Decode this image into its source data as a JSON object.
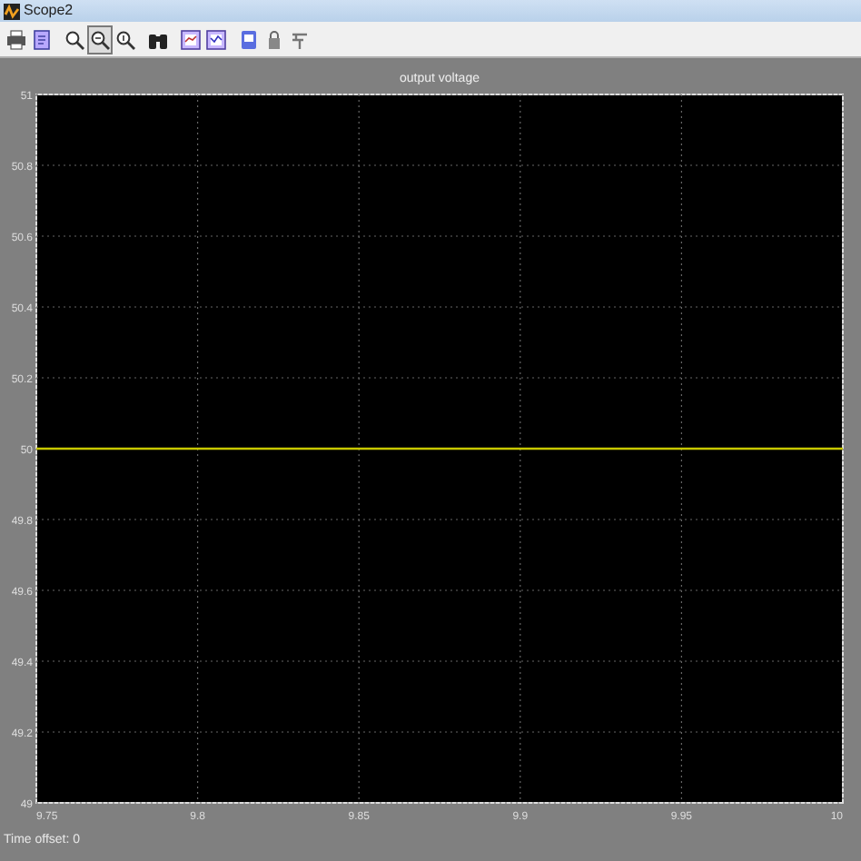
{
  "window": {
    "title": "Scope2"
  },
  "toolbar": {
    "buttons": [
      {
        "kind": "print"
      },
      {
        "kind": "params"
      },
      {
        "kind": "zoom"
      },
      {
        "kind": "zoom-x",
        "selected": true
      },
      {
        "kind": "zoom-y"
      },
      {
        "kind": "autoscale"
      },
      {
        "kind": "save-axes"
      },
      {
        "kind": "restore-axes"
      },
      {
        "kind": "floating"
      },
      {
        "kind": "lock"
      },
      {
        "kind": "signal"
      }
    ]
  },
  "plot": {
    "chart_data": {
      "type": "line",
      "title": "output voltage",
      "x": [
        9.75,
        10
      ],
      "grid": true,
      "series": [
        {
          "color": "#c8c800",
          "values": [
            50,
            50
          ]
        }
      ],
      "xlim": [
        9.75,
        10
      ],
      "ylim": [
        49,
        51
      ],
      "xticks": [
        {
          "value": 9.75,
          "label": "9.75"
        },
        {
          "value": 9.8,
          "label": "9.8"
        },
        {
          "value": 9.85,
          "label": "9.85"
        },
        {
          "value": 9.9,
          "label": "9.9"
        },
        {
          "value": 9.95,
          "label": "9.95"
        },
        {
          "value": 10,
          "label": "10"
        }
      ],
      "yticks": [
        {
          "value": 51,
          "label": "51"
        },
        {
          "value": 50.8,
          "label": "50.8"
        },
        {
          "value": 50.6,
          "label": "50.6"
        },
        {
          "value": 50.4,
          "label": "50.4"
        },
        {
          "value": 50.2,
          "label": "50.2"
        },
        {
          "value": 50,
          "label": "50"
        },
        {
          "value": 49.8,
          "label": "49.8"
        },
        {
          "value": 49.6,
          "label": "49.6"
        },
        {
          "value": 49.4,
          "label": "49.4"
        },
        {
          "value": 49.2,
          "label": "49.2"
        },
        {
          "value": 49,
          "label": "49"
        }
      ]
    }
  },
  "status_bar": {
    "text": "Time offset:  0"
  }
}
